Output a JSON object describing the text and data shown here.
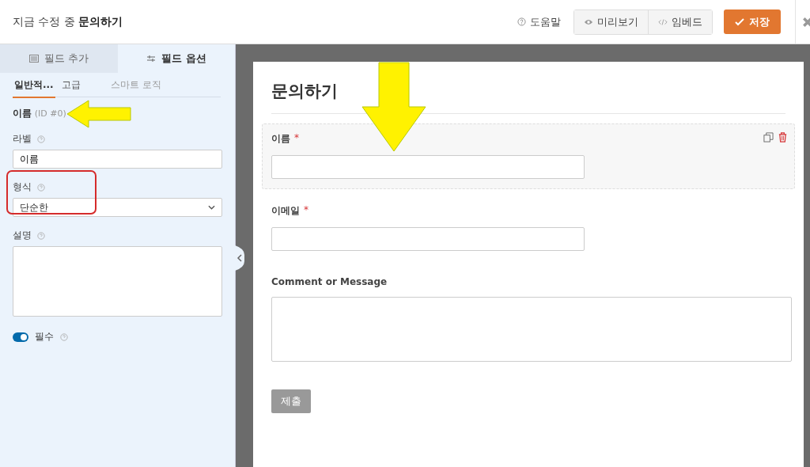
{
  "header": {
    "title_prefix": "지금 수정 중",
    "title_form": "문의하기",
    "help": "도움말",
    "buttons": [
      {
        "label": "미리보기",
        "kind": "preview"
      },
      {
        "label": "임베드",
        "kind": "embed"
      }
    ],
    "save": "저장"
  },
  "sidebar": {
    "tabs": [
      {
        "label": "필드 추가",
        "kind": "add",
        "selected": false
      },
      {
        "label": "필드 옵션",
        "kind": "options",
        "selected": true
      }
    ],
    "subtabs": [
      {
        "label": "일반적...",
        "selected": true
      },
      {
        "label": "고급",
        "selected": false
      },
      {
        "label": "스마트 로직",
        "selected": false
      }
    ],
    "field_heading": {
      "name": "이름",
      "id": "(ID #0)"
    },
    "label_field": {
      "label": "라벨",
      "value": "이름"
    },
    "format_field": {
      "label": "형식",
      "value": "단순한"
    },
    "description_field": {
      "label": "설명"
    },
    "required_toggle": {
      "label": "필수",
      "on": true
    }
  },
  "form": {
    "title": "문의하기",
    "fields": [
      {
        "label": "이름",
        "kind": "text",
        "required": true,
        "selected": true
      },
      {
        "label": "이메일",
        "kind": "text",
        "required": true,
        "selected": false
      },
      {
        "label": "Comment or Message",
        "kind": "textarea",
        "required": false,
        "selected": false
      }
    ],
    "required_mark": "*",
    "submit": "제출"
  }
}
